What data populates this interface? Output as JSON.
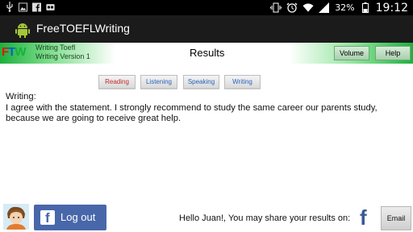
{
  "status_bar": {
    "left_icons": [
      "usb-icon",
      "image-icon",
      "facebook-icon",
      "voicemail-icon"
    ],
    "right_icons": [
      "vibrate-icon",
      "alarm-icon",
      "wifi-icon",
      "signal-icon"
    ],
    "battery": "32%",
    "time": "19:12"
  },
  "app_bar": {
    "title": "FreeTOEFLWriting"
  },
  "header": {
    "logo": {
      "f": "F",
      "t": "T",
      "w": "W"
    },
    "subtitle_line1": "Writing Toefl",
    "subtitle_line2": "Writing Version 1",
    "title": "Results",
    "volume_label": "Volume",
    "help_label": "Help",
    "colors": {
      "green": "#1db03d",
      "logo_red": "#e01414",
      "logo_blue": "#0a5ad8",
      "logo_green": "#16b03a"
    }
  },
  "tabs": {
    "reading": "Reading",
    "listening": "Listening",
    "speaking": "Speaking",
    "writing": "Writing"
  },
  "content": {
    "heading": "Writing:",
    "body": "I agree with the statement. I strongly recommend to study the same career our parents study, because we are going to receive great help."
  },
  "footer": {
    "logout_label": "Log out",
    "share_text": "Hello Juan!, You may share your results on:",
    "email_label": "Email",
    "colors": {
      "facebook_blue": "#4867aa"
    }
  }
}
